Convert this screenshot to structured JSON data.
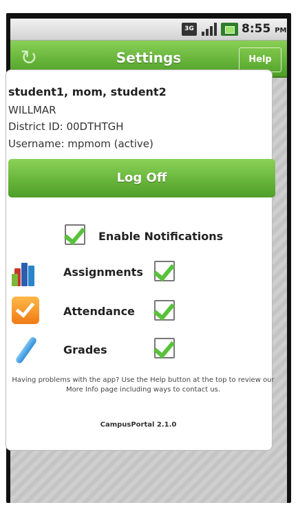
{
  "status_bar": {
    "network_icon": "3g-icon",
    "network_label": "3G",
    "signal_icon": "signal-bars-icon",
    "battery_icon": "battery-icon",
    "time": "8:55",
    "ampm": "PM"
  },
  "title_bar": {
    "refresh_icon": "refresh-icon",
    "title": "Settings",
    "help_label": "Help"
  },
  "account": {
    "names": "student1, mom, student2",
    "district": "WILLMAR",
    "district_id": "District ID: 00DTHTGH",
    "username": "Username: mpmom (active)"
  },
  "logoff_label": "Log Off",
  "notifications": {
    "enable_label": "Enable Notifications",
    "enabled": true,
    "options": [
      {
        "label": "Assignments",
        "checked": true,
        "icon": "books-icon"
      },
      {
        "label": "Attendance",
        "checked": true,
        "icon": "checkmark-app-icon"
      },
      {
        "label": "Grades",
        "checked": true,
        "icon": "pen-icon"
      }
    ]
  },
  "help_text": "Having problems with the app? Use the Help button at the top to review our More Info page including ways to contact us.",
  "version": "CampusPortal 2.1.0",
  "colors": {
    "accent_green": "#5aaa2e",
    "check_green": "#58c23a"
  }
}
